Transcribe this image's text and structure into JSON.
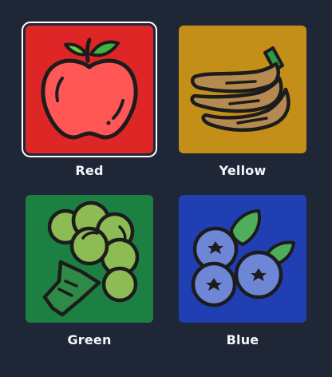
{
  "options": [
    {
      "label": "Red",
      "color": "#de2626",
      "icon": "apple-icon",
      "selected": true
    },
    {
      "label": "Yellow",
      "color": "#c38f19",
      "icon": "banana-icon",
      "selected": false
    },
    {
      "label": "Green",
      "color": "#1c8043",
      "icon": "broccoli-icon",
      "selected": false
    },
    {
      "label": "Blue",
      "color": "#1f3fb3",
      "icon": "blueberries-icon",
      "selected": false
    }
  ]
}
